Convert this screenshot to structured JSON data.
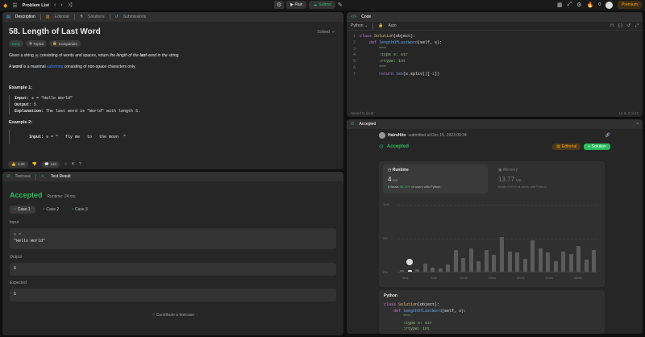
{
  "topbar": {
    "problem_list": "Problem List",
    "run": "Run",
    "submit": "Submit",
    "streak": "0",
    "premium": "Premium"
  },
  "left_tabs": [
    "Description",
    "Editorial",
    "Solutions",
    "Submissions"
  ],
  "problem": {
    "title": "58. Length of Last Word",
    "status": "Solved",
    "difficulty": "Easy",
    "topics": "Topics",
    "companies": "Companies",
    "desc1_a": "Given a string ",
    "desc1_s": "s",
    "desc1_b": " consisting of words and spaces, return ",
    "desc1_c": "the length of the ",
    "desc1_d": "last",
    "desc1_e": " word in the string.",
    "desc2_a": "A ",
    "desc2_b": "word",
    "desc2_c": " is a maximal ",
    "desc2_d": "substring",
    "desc2_e": " consisting of non-space characters only.",
    "ex1_title": "Example 1:",
    "ex1_input_label": "Input:",
    "ex1_input": " s = \"Hello World\"",
    "ex1_output_label": "Output:",
    "ex1_output": " 5",
    "ex1_expl_label": "Explanation:",
    "ex1_expl": " The last word is \"World\" with length 5.",
    "ex2_title": "Example 2:",
    "ex2_input_label": "Input:",
    "ex2_input": " s = \"   fly me   to   the moon  \"",
    "likes": "4.3K",
    "comments": "141"
  },
  "bottom_tabs": {
    "testcase": "Testcase",
    "result": "Test Result"
  },
  "result": {
    "status": "Accepted",
    "runtime": "Runtime: 24 ms",
    "cases": [
      "Case 1",
      "Case 2",
      "Case 3"
    ],
    "input_label": "Input",
    "input_var": "s =",
    "input_val": "\"Hello World\"",
    "output_label": "Output",
    "output_val": "5",
    "expected_label": "Expected",
    "expected_val": "5",
    "contribute": "Contribute a testcase"
  },
  "code": {
    "header": "Code",
    "language": "Python",
    "auto": "Auto",
    "saved": "Saved to local",
    "cursor": "Ln 6, Col 12",
    "lines": [
      [
        {
          "t": "class ",
          "c": "kw"
        },
        {
          "t": "Solution",
          "c": "cls"
        },
        {
          "t": "(object):",
          "c": ""
        }
      ],
      [
        {
          "t": "    def ",
          "c": "kw"
        },
        {
          "t": "lengthOfLastWord",
          "c": "fn"
        },
        {
          "t": "(self, s):",
          "c": ""
        }
      ],
      [
        {
          "t": "        \"\"\"",
          "c": "str"
        }
      ],
      [
        {
          "t": "        :type s: str",
          "c": "str"
        }
      ],
      [
        {
          "t": "        :rtype: int",
          "c": "str"
        }
      ],
      [
        {
          "t": "        \"\"\"",
          "c": "str"
        }
      ],
      [
        {
          "t": "        return ",
          "c": "kw"
        },
        {
          "t": "len",
          "c": "fn"
        },
        {
          "t": "(s.split()[",
          "c": ""
        },
        {
          "t": "-1",
          "c": "num"
        },
        {
          "t": "])",
          "c": ""
        }
      ]
    ]
  },
  "accepted": {
    "header": "Accepted",
    "user": "HairoHito",
    "submitted": " submitted at Dec 15, 2023 09:34",
    "status": "Accepted",
    "editorial": "Editorial",
    "solution": "Solution",
    "runtime_label": "Runtime",
    "runtime_val": "4",
    "runtime_unit": "ms",
    "runtime_beats_a": "Beats ",
    "runtime_beats_pct": "96.34%",
    "runtime_beats_b": " of users with Python",
    "memory_label": "Memory",
    "memory_val": "13.77",
    "memory_unit": "MB",
    "memory_beats": "Beats 9.51% of users with Python",
    "lang": "Python"
  },
  "chart_data": {
    "type": "bar",
    "ylabels": [
      "10%",
      "5%",
      "0%"
    ],
    "xlabels": [
      "4ms",
      "8ms",
      "12ms",
      "16ms",
      "20ms",
      "24ms",
      "28ms"
    ],
    "values": [
      0.2,
      0.2,
      0.3,
      1.2,
      0.6,
      0.5,
      1.1,
      3.2,
      2.0,
      3.5,
      1.5,
      3.2,
      2.5,
      5.1,
      3.0,
      2.8,
      1.9,
      4.6,
      3.5,
      2.8,
      1.6,
      3.0,
      2.6,
      3.8,
      1.8,
      3.2
    ],
    "ylim": [
      0,
      10
    ]
  },
  "code2": {
    "lines": [
      [
        {
          "t": "class ",
          "c": "kw"
        },
        {
          "t": "Solution",
          "c": "cls"
        },
        {
          "t": "(object):",
          "c": ""
        }
      ],
      [
        {
          "t": "    def ",
          "c": "kw"
        },
        {
          "t": "lengthOfLastWord",
          "c": "fn"
        },
        {
          "t": "(self, s):",
          "c": ""
        }
      ],
      [
        {
          "t": "        \"\"\"",
          "c": "str"
        }
      ],
      [
        {
          "t": "        :type s: str",
          "c": "str"
        }
      ],
      [
        {
          "t": "        :rtype: int",
          "c": "str"
        }
      ]
    ]
  }
}
